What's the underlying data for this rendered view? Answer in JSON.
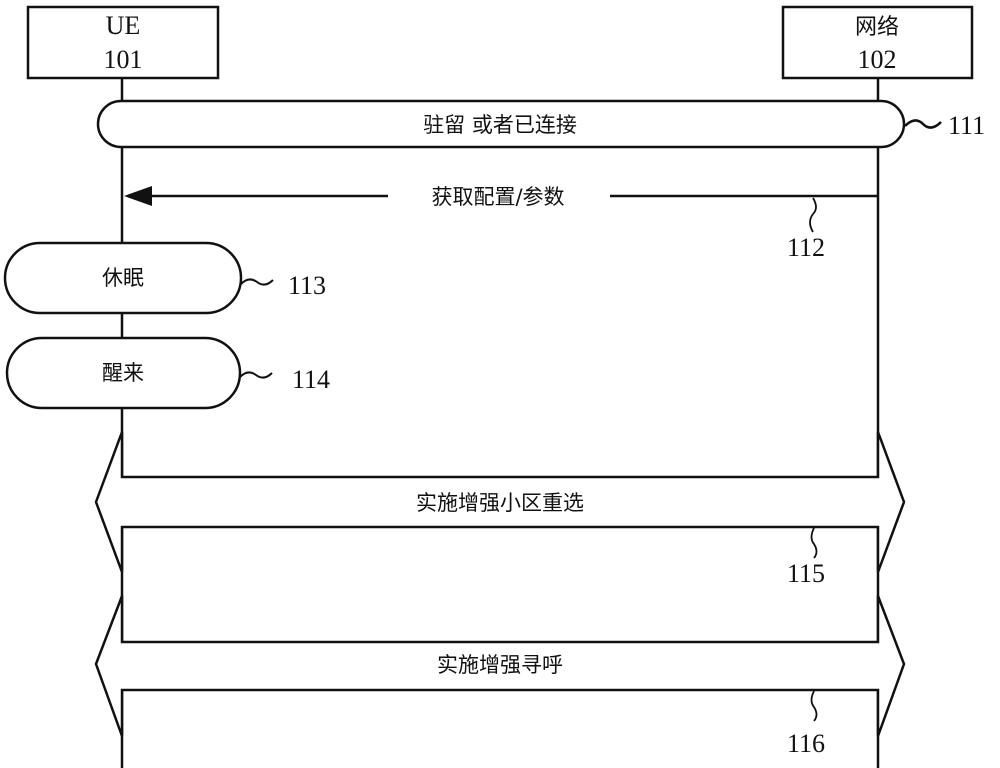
{
  "entities": [
    {
      "id": "ue",
      "name": "UE",
      "ref": "101"
    },
    {
      "id": "net",
      "name": "网络",
      "ref": "102"
    }
  ],
  "steps": [
    {
      "id": "s111",
      "kind": "span",
      "label": "驻留 或者已连接",
      "ref": "111"
    },
    {
      "id": "s112",
      "kind": "arrow-to-ue",
      "label": "获取配置/参数",
      "ref": "112"
    },
    {
      "id": "s113",
      "kind": "ue-state",
      "label": "休眠",
      "ref": "113"
    },
    {
      "id": "s114",
      "kind": "ue-state",
      "label": "醒来",
      "ref": "114"
    },
    {
      "id": "s115",
      "kind": "bidirectional",
      "label": "实施增强小区重选",
      "ref": "115"
    },
    {
      "id": "s116",
      "kind": "bidirectional",
      "label": "实施增强寻呼",
      "ref": "116"
    }
  ]
}
